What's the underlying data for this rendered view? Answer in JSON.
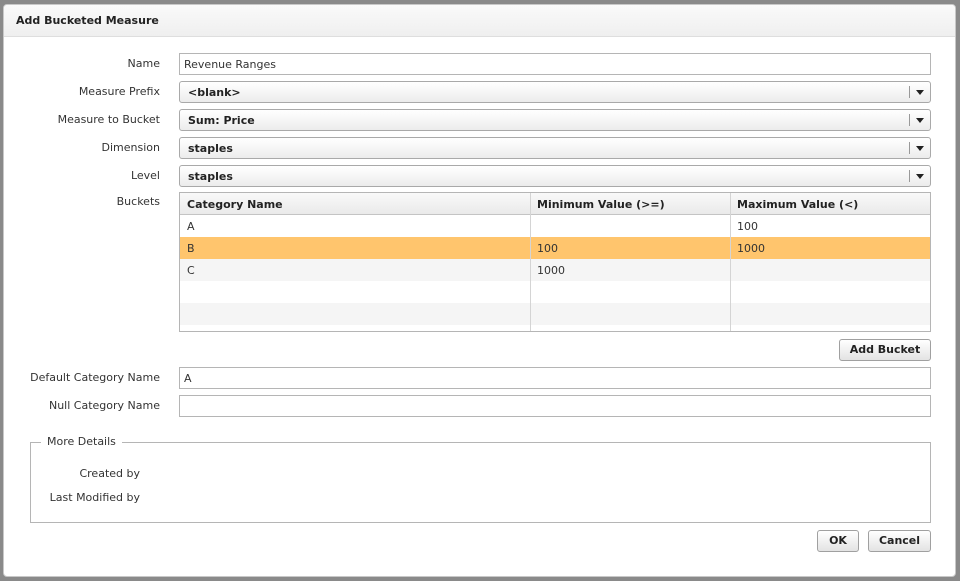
{
  "dialog": {
    "title": "Add Bucketed Measure"
  },
  "form": {
    "name_label": "Name",
    "name_value": "Revenue Ranges",
    "measure_prefix_label": "Measure Prefix",
    "measure_prefix_value": "<blank>",
    "measure_to_bucket_label": "Measure to Bucket",
    "measure_to_bucket_value": "Sum: Price",
    "dimension_label": "Dimension",
    "dimension_value": "staples",
    "level_label": "Level",
    "level_value": "staples",
    "buckets_label": "Buckets",
    "default_category_label": "Default Category Name",
    "default_category_value": "A",
    "null_category_label": "Null Category Name",
    "null_category_value": ""
  },
  "buckets_grid": {
    "columns": [
      "Category Name",
      "Minimum Value (>=)",
      "Maximum Value (<)"
    ],
    "rows": [
      {
        "category": "A",
        "min": "",
        "max": "100"
      },
      {
        "category": "B",
        "min": "100",
        "max": "1000"
      },
      {
        "category": "C",
        "min": "1000",
        "max": ""
      }
    ],
    "selected_row": "B"
  },
  "buttons": {
    "add_bucket": "Add Bucket",
    "ok": "OK",
    "cancel": "Cancel"
  },
  "more_details": {
    "legend": "More Details",
    "created_by_label": "Created by",
    "created_by_value": "",
    "last_modified_by_label": "Last Modified by",
    "last_modified_by_value": ""
  },
  "colors": {
    "selected_row": "#ffc56d",
    "alt_row": "#f5f5f5"
  }
}
